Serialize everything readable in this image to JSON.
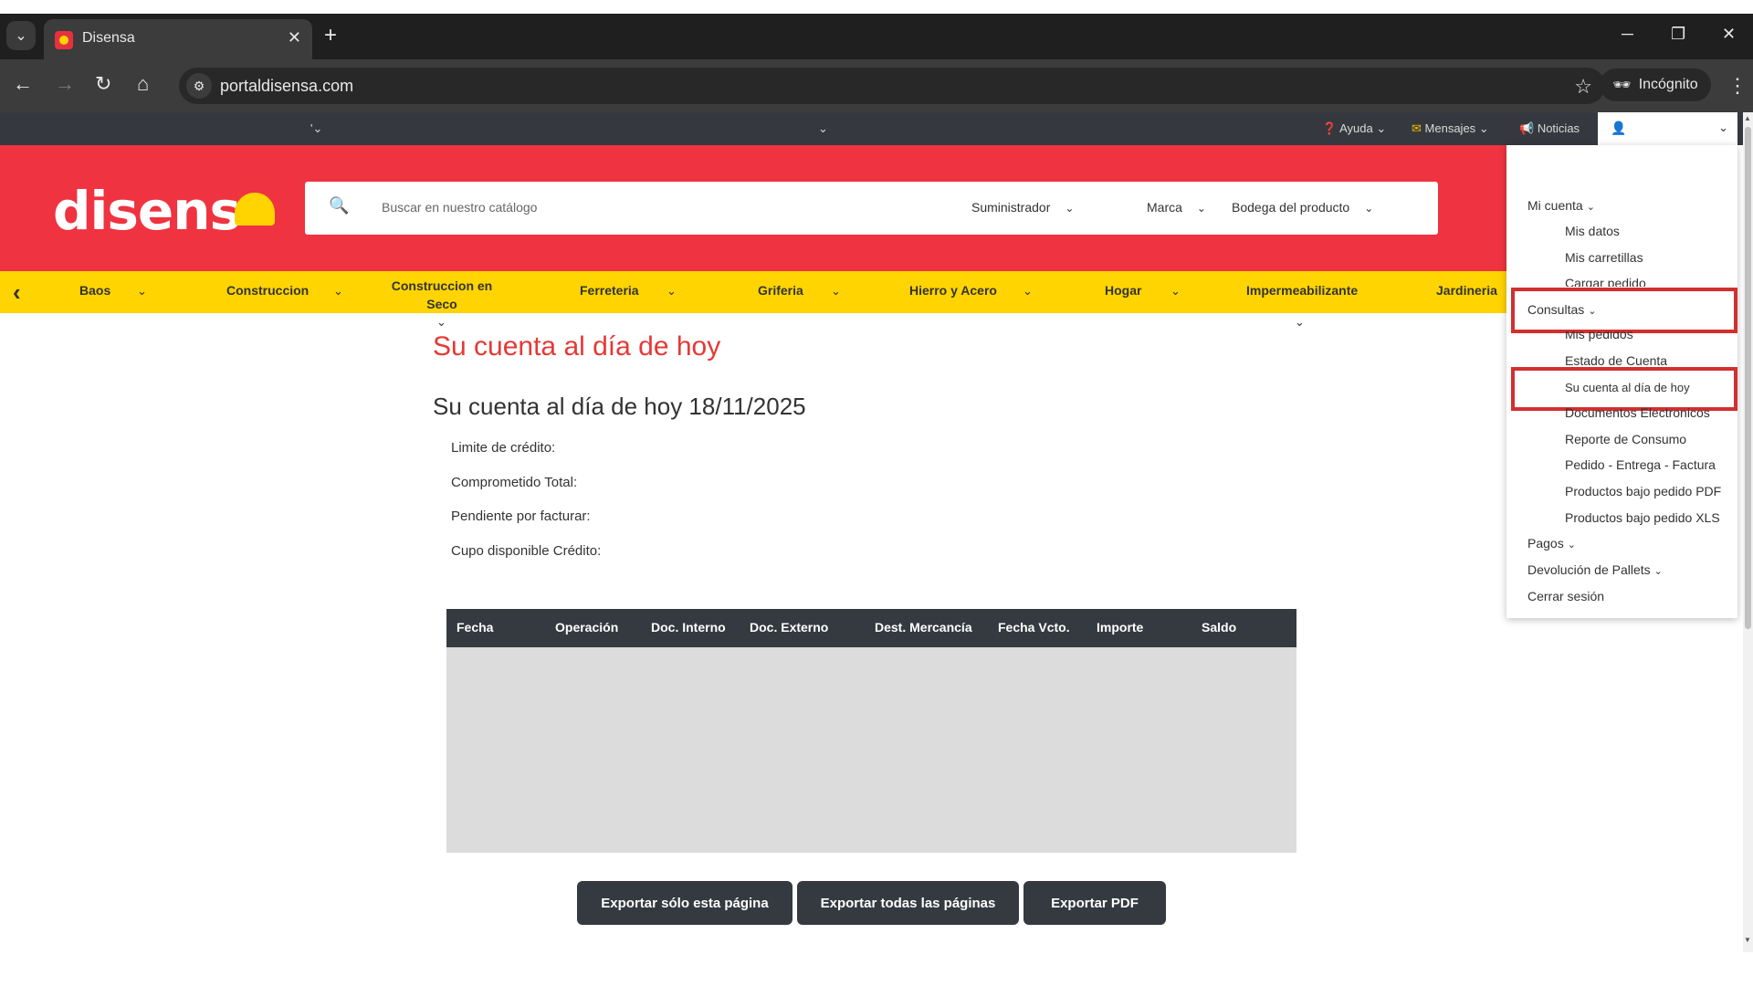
{
  "browser": {
    "tab_title": "Disensa",
    "tab_close": "✕",
    "new_tab": "+",
    "url": "portaldisensa.com",
    "incognito_label": "Incógnito",
    "icons": [
      "back-icon",
      "forward-icon",
      "reload-icon",
      "home-icon",
      "star-icon",
      "incognito-icon",
      "kebab-icon"
    ]
  },
  "utilbar": {
    "ayuda": "Ayuda",
    "mensajes": "Mensajes",
    "noticias": "Noticias",
    "left_marker": "'"
  },
  "header": {
    "logo": "disens",
    "search_placeholder": "Buscar en nuestro catálogo",
    "filters": [
      "Suministrador",
      "Marca",
      "Bodega del producto"
    ]
  },
  "categories": [
    {
      "label": "Baos"
    },
    {
      "label": "Construccion"
    },
    {
      "label": "Construccion en Seco"
    },
    {
      "label": "Ferreteria"
    },
    {
      "label": "Griferia"
    },
    {
      "label": "Hierro y Acero"
    },
    {
      "label": "Hogar"
    },
    {
      "label": "Impermeabilizante"
    },
    {
      "label": "Jardineria"
    }
  ],
  "main": {
    "page_title": "Su cuenta al día de hoy",
    "sub_title": "Su cuenta al día de hoy 18/11/2025",
    "fields": [
      "Limite de crédito:",
      "Comprometido Total:",
      "Pendiente por facturar:",
      "Cupo disponible Crédito:"
    ],
    "table_headers": [
      "Fecha",
      "Operación",
      "Doc. Interno",
      "Doc. Externo",
      "Dest. Mercancía",
      "Fecha Vcto.",
      "Importe",
      "Saldo"
    ],
    "buttons": [
      "Exportar sólo esta página",
      "Exportar todas las páginas",
      "Exportar PDF"
    ]
  },
  "dropdown": {
    "mi_cuenta": "Mi cuenta",
    "mi_cuenta_items": [
      "Mis datos",
      "Mis carretillas",
      "Cargar pedido"
    ],
    "consultas": "Consultas",
    "consultas_items": [
      "Mis pedidos",
      "Estado de Cuenta",
      "Su cuenta al día de hoy",
      "Documentos Electronicos",
      "Reporte de Consumo",
      "Pedido - Entrega - Factura",
      "Productos bajo pedido PDF",
      "Productos bajo pedido XLS"
    ],
    "pagos": "Pagos",
    "devolucion": "Devolución de Pallets",
    "cerrar": "Cerrar sesión"
  },
  "colors": {
    "brand_red": "#ef3340",
    "brand_yellow": "#ffd400",
    "dark": "#343a40",
    "highlight": "#d32f2f"
  }
}
